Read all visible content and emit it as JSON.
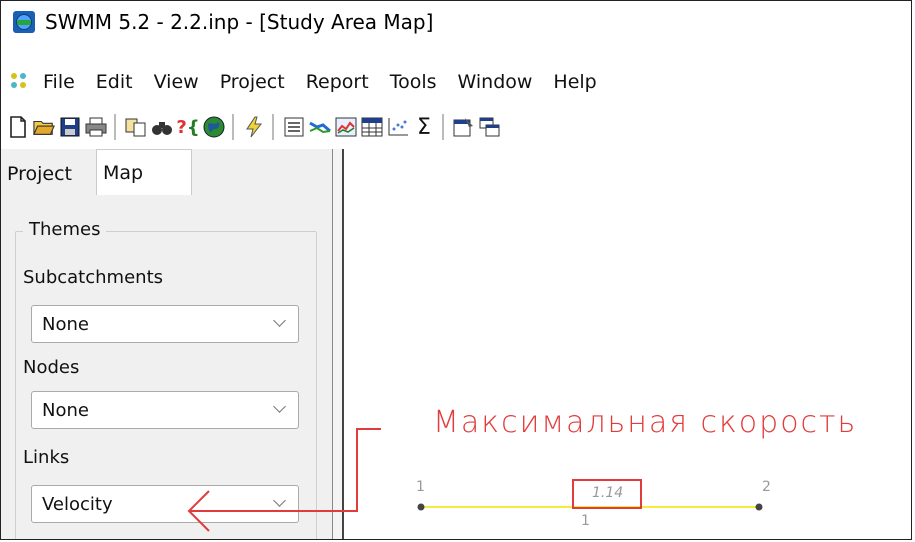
{
  "window": {
    "title": "SWMM 5.2 - 2.2.inp - [Study Area Map]"
  },
  "menu": {
    "items": [
      "File",
      "Edit",
      "View",
      "Project",
      "Report",
      "Tools",
      "Window",
      "Help"
    ]
  },
  "toolbar": {
    "icons": [
      "new-file-icon",
      "open-folder-icon",
      "save-icon",
      "print-icon",
      "copy-icon",
      "find-icon",
      "query-icon",
      "globe-icon",
      "run-icon",
      "status-report-icon",
      "profile-plot-icon",
      "time-series-plot-icon",
      "table-icon",
      "scatter-plot-icon",
      "statistics-icon",
      "options-icon",
      "tile-windows-icon"
    ]
  },
  "panel": {
    "tabs": {
      "project": "Project",
      "map": "Map"
    },
    "themes_legend": "Themes",
    "subcatchments": {
      "label": "Subcatchments",
      "value": "None"
    },
    "nodes": {
      "label": "Nodes",
      "value": "None"
    },
    "links": {
      "label": "Links",
      "value": "Velocity"
    }
  },
  "map": {
    "annotation": "Максимальная  скорость",
    "node_left_id": "1",
    "node_right_id": "2",
    "link_value": "1.14",
    "link_id": "1",
    "colors": {
      "link": "#f2ee3a",
      "annotation": "#e23b3b",
      "node": "#444444"
    }
  }
}
